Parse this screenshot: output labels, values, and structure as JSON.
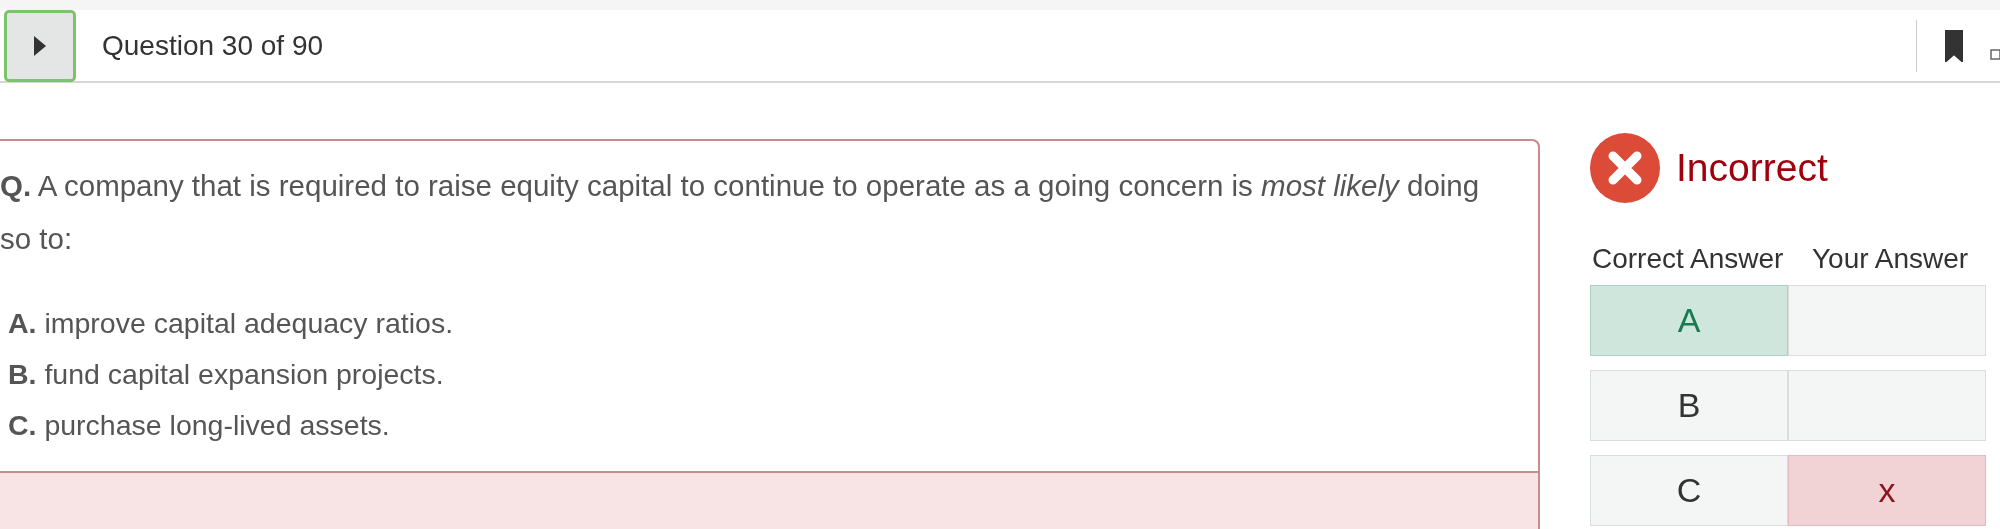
{
  "header": {
    "title": "Question 30 of 90",
    "bookmarked": true
  },
  "question": {
    "text": "**Q.** A company that is required to raise equity capital to continue to operate as a going concern is *most likely* doing so to:",
    "options": [
      "**A.** improve capital adequacy ratios.",
      "**B.** fund capital expansion projects.",
      "**C.** purchase long-lived assets."
    ]
  },
  "result": {
    "status": "Incorrect",
    "correct": false,
    "columns": [
      "Correct Answer",
      "Your Answer"
    ],
    "answers": [
      {
        "letter": "A",
        "correct": true,
        "chosen": false
      },
      {
        "letter": "B",
        "correct": false,
        "chosen": false
      },
      {
        "letter": "C",
        "correct": false,
        "chosen": true,
        "mark": "x"
      }
    ]
  }
}
